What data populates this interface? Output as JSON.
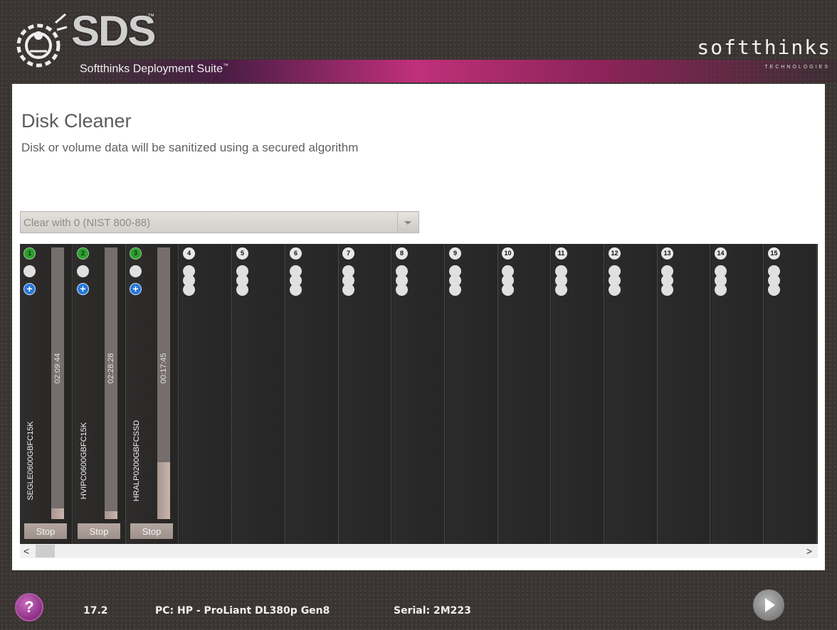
{
  "header": {
    "logo_text": "SDS",
    "logo_tm": "™",
    "suite_name": "Softthinks Deployment Suite",
    "suite_tm": "™",
    "brand": "softthinks",
    "brand_sub": "TECHNOLOGIES"
  },
  "page": {
    "title": "Disk Cleaner",
    "subtitle": "Disk or volume data will be sanitized using a secured algorithm"
  },
  "algorithm": {
    "selected": "Clear with 0 (NIST 800-88)"
  },
  "slots": [
    {
      "number": "1",
      "active": true,
      "device": "SEGLE0600GBFC15K",
      "time": "02:09:44",
      "progress": 0.04,
      "stop_label": "Stop"
    },
    {
      "number": "2",
      "active": true,
      "device": "HVIPC0600GBFC15K",
      "time": "02:28:28",
      "progress": 0.03,
      "stop_label": "Stop"
    },
    {
      "number": "3",
      "active": true,
      "device": "HRALP0200GBFCSSD",
      "time": "00:17:45",
      "progress": 0.21,
      "stop_label": "Stop"
    },
    {
      "number": "4",
      "active": false
    },
    {
      "number": "5",
      "active": false
    },
    {
      "number": "6",
      "active": false
    },
    {
      "number": "7",
      "active": false
    },
    {
      "number": "8",
      "active": false
    },
    {
      "number": "9",
      "active": false
    },
    {
      "number": "10",
      "active": false
    },
    {
      "number": "11",
      "active": false
    },
    {
      "number": "12",
      "active": false
    },
    {
      "number": "13",
      "active": false
    },
    {
      "number": "14",
      "active": false
    },
    {
      "number": "15",
      "active": false
    }
  ],
  "scrollbar": {
    "left_arrow": "<",
    "right_arrow": ">"
  },
  "footer": {
    "help_label": "?",
    "version": "17.2",
    "pc": "PC: HP - ProLiant DL380p Gen8",
    "serial": "Serial: 2M223"
  },
  "colors": {
    "status_green": "#2f9d2f",
    "add_blue": "#2878d6",
    "accent_magenta": "#c0307a"
  }
}
